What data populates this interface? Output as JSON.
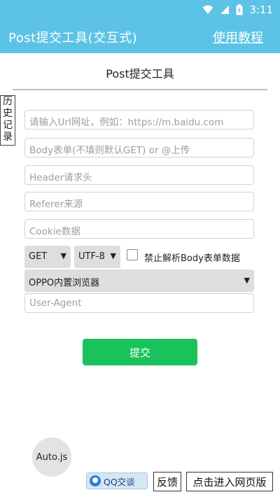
{
  "status_bar": {
    "time": "3:11",
    "icons": [
      "wifi-icon",
      "signal-icon",
      "battery-charging-icon"
    ]
  },
  "app_bar": {
    "title": "Post提交工具(交互式)",
    "help_link": "使用教程"
  },
  "page": {
    "title": "Post提交工具",
    "history_tab": "历史记录"
  },
  "form": {
    "url_placeholder": "请输入Url网址，例如：https://m.baidu.com",
    "body_placeholder": "Body表单(不填则默认GET) or @上传",
    "header_placeholder": "Header请求头",
    "referer_placeholder": "Referer来源",
    "cookie_placeholder": "Cookie数据",
    "method_value": "GET",
    "encoding_value": "UTF-8",
    "disable_body_parse_label": "禁止解析Body表单数据",
    "disable_body_parse_checked": false,
    "browser_value": "OPPO内置浏览器",
    "user_agent_placeholder": "User-Agent",
    "submit_label": "提交"
  },
  "bottom": {
    "fab_label": "Auto.js",
    "qq_label": "QQ交谈",
    "feedback_label": "反馈",
    "web_version_label": "点击进入网页版"
  },
  "colors": {
    "app_bar": "#5cc3e6",
    "submit": "#19c25b",
    "select_bg": "#dedede"
  }
}
